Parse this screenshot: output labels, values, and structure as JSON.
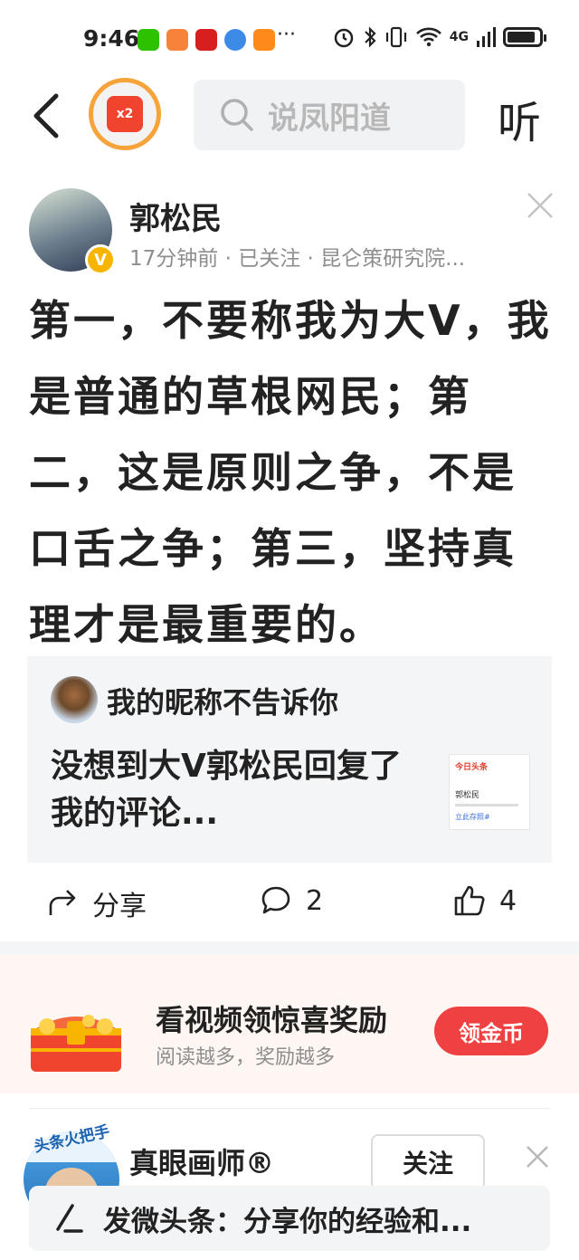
{
  "status_bar": {
    "time": "9:46",
    "more": "···",
    "network": "4G"
  },
  "nav": {
    "reward_badge": "x2",
    "search_placeholder": "说凤阳道",
    "listen_label": "听"
  },
  "post": {
    "author": "郭松民",
    "verified_badge": "V",
    "meta": "17分钟前 · 已关注 · 昆仑策研究院...",
    "body": "第一，不要称我为大V，我是普通的草根网民；第二，这是原则之争，不是口舌之争；第三，坚持真理才是最重要的。"
  },
  "quote": {
    "user": "我的昵称不告诉你",
    "text": "没想到大V郭松民回复了我的评论...",
    "thumb_title": "今日头条",
    "thumb_name": "郭松民",
    "thumb_tag": "立此存照#"
  },
  "actions": {
    "share_label": "分享",
    "comment_count": "2",
    "like_count": "4"
  },
  "promo": {
    "title": "看视频领惊喜奖励",
    "subtitle": "阅读越多，奖励越多",
    "button": "领金币"
  },
  "next_post": {
    "avatar_label": "头条火把手",
    "author": "真眼画师®",
    "follow_label": "关注"
  },
  "composer": {
    "placeholder": "发微头条：分享你的经验和..."
  },
  "colors": {
    "accent_red": "#f04142",
    "badge_gold": "#f7b500",
    "muted_text": "#8e8e8e"
  }
}
